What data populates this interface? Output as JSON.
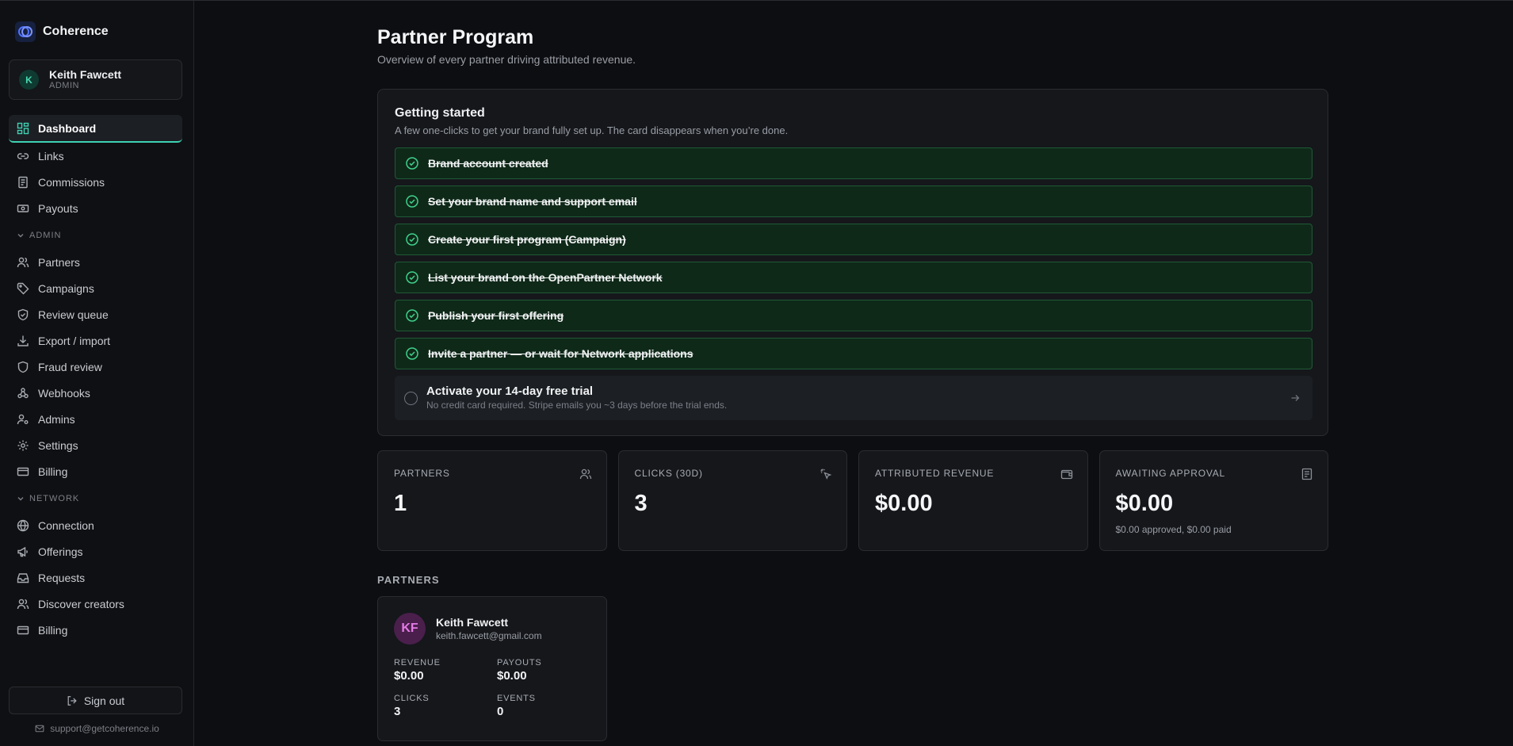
{
  "app": {
    "name": "Coherence"
  },
  "user": {
    "initial": "K",
    "name": "Keith Fawcett",
    "role": "ADMIN"
  },
  "nav": {
    "main": [
      {
        "label": "Dashboard",
        "icon": "dashboard-icon",
        "active": true
      },
      {
        "label": "Links",
        "icon": "link-icon"
      },
      {
        "label": "Commissions",
        "icon": "receipt-icon"
      },
      {
        "label": "Payouts",
        "icon": "cash-icon"
      }
    ],
    "admin_title": "ADMIN",
    "admin": [
      {
        "label": "Partners",
        "icon": "users-icon"
      },
      {
        "label": "Campaigns",
        "icon": "tag-icon"
      },
      {
        "label": "Review queue",
        "icon": "shield-check-icon"
      },
      {
        "label": "Export / import",
        "icon": "download-icon"
      },
      {
        "label": "Fraud review",
        "icon": "shield-icon"
      },
      {
        "label": "Webhooks",
        "icon": "webhook-icon"
      },
      {
        "label": "Admins",
        "icon": "user-cog-icon"
      },
      {
        "label": "Settings",
        "icon": "gear-icon"
      },
      {
        "label": "Billing",
        "icon": "credit-card-icon"
      }
    ],
    "network_title": "NETWORK",
    "network": [
      {
        "label": "Connection",
        "icon": "globe-icon"
      },
      {
        "label": "Offerings",
        "icon": "megaphone-icon"
      },
      {
        "label": "Requests",
        "icon": "inbox-icon"
      },
      {
        "label": "Discover creators",
        "icon": "users-icon"
      },
      {
        "label": "Billing",
        "icon": "credit-card-icon"
      }
    ]
  },
  "sidebar_footer": {
    "signout": "Sign out",
    "support": "support@getcoherence.io"
  },
  "page": {
    "title": "Partner Program",
    "subtitle": "Overview of every partner driving attributed revenue."
  },
  "getting_started": {
    "title": "Getting started",
    "subtitle": "A few one-clicks to get your brand fully set up. The card disappears when you’re done.",
    "steps": [
      "Brand account created",
      "Set your brand name and support email",
      "Create your first program (Campaign)",
      "List your brand on the OpenPartner Network",
      "Publish your first offering",
      "Invite a partner — or wait for Network applications"
    ],
    "trial": {
      "title": "Activate your 14-day free trial",
      "subtitle": "No credit card required. Stripe emails you ~3 days before the trial ends."
    }
  },
  "stats": [
    {
      "label": "PARTNERS",
      "value": "1",
      "note": "",
      "icon": "users-icon"
    },
    {
      "label": "CLICKS (30D)",
      "value": "3",
      "note": "",
      "icon": "pointer-click-icon"
    },
    {
      "label": "ATTRIBUTED REVENUE",
      "value": "$0.00",
      "note": "",
      "icon": "wallet-icon"
    },
    {
      "label": "AWAITING APPROVAL",
      "value": "$0.00",
      "note": "$0.00 approved, $0.00 paid",
      "icon": "receipt-icon"
    }
  ],
  "partners_section": {
    "heading": "PARTNERS",
    "items": [
      {
        "initials": "KF",
        "name": "Keith Fawcett",
        "email": "keith.fawcett@gmail.com",
        "revenue_label": "REVENUE",
        "revenue": "$0.00",
        "payouts_label": "PAYOUTS",
        "payouts": "$0.00",
        "clicks_label": "CLICKS",
        "clicks": "3",
        "events_label": "EVENTS",
        "events": "0"
      }
    ]
  },
  "colors": {
    "accent": "#3fd1b3",
    "success_bg": "#0f2919",
    "success_border": "#1f5a35",
    "background": "#0d0e11"
  }
}
